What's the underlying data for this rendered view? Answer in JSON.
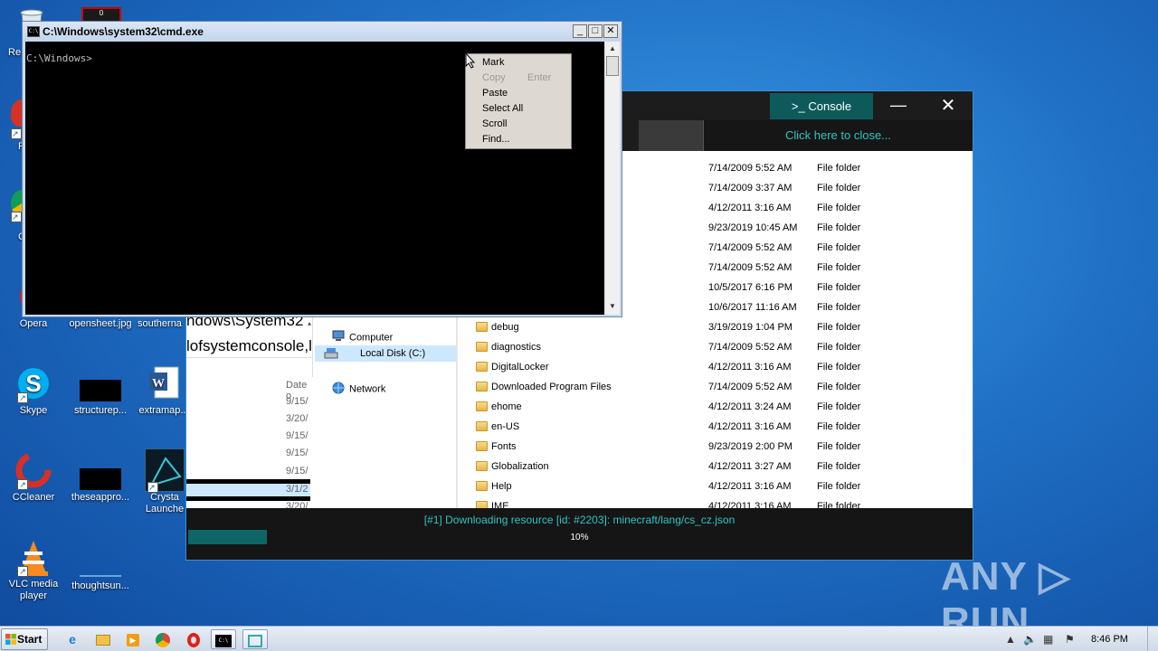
{
  "desktop": {
    "icons": [
      {
        "label": "Re",
        "name": "recycle-bin"
      },
      {
        "label": "Opera",
        "name": "opera"
      },
      {
        "label": "opensheet.jpg",
        "name": "opensheet"
      },
      {
        "label": "southerna",
        "name": "southerna"
      },
      {
        "label": "Skype",
        "name": "skype"
      },
      {
        "label": "structurep...",
        "name": "structurep"
      },
      {
        "label": "extramap...",
        "name": "extramap"
      },
      {
        "label": "CCleaner",
        "name": "ccleaner"
      },
      {
        "label": "theseappro...",
        "name": "theseappro"
      },
      {
        "label": "Crysta Launche",
        "name": "crystal-launcher"
      },
      {
        "label": "VLC media player",
        "name": "vlc"
      },
      {
        "label": "thoughtsun...",
        "name": "thoughtsun"
      }
    ],
    "partial_labels": [
      "F",
      "C"
    ]
  },
  "cmd": {
    "title": "C:\\Windows\\system32\\cmd.exe",
    "prompt": "C:\\Windows>",
    "menu": {
      "mark": "Mark",
      "copy": "Copy",
      "copy_shortcut": "Enter",
      "paste": "Paste",
      "select_all": "Select All",
      "scroll": "Scroll",
      "find": "Find..."
    }
  },
  "app": {
    "console_button": ">_ Console",
    "click_to_close": "Click here to close...",
    "status": "[#1] Downloading resource [id: #2203]: minecraft/lang/cs_cz.json",
    "progress_label": "10%",
    "progress_value": 0.1
  },
  "explorer": {
    "path_line1": "ndows\\System32",
    "path_line2": "lofsystemconsole,l",
    "date_header": "Date o",
    "date_cells": [
      "9/15/",
      "3/20/",
      "9/15/",
      "9/15/",
      "9/15/",
      "3/1/2",
      "3/20/"
    ],
    "nav": {
      "computer": "Computer",
      "local_disk": "Local Disk (C:)",
      "network": "Network"
    },
    "files": [
      {
        "name": "",
        "date": "7/14/2009 5:52 AM",
        "type": "File folder"
      },
      {
        "name": "",
        "date": "7/14/2009 3:37 AM",
        "type": "File folder"
      },
      {
        "name": "",
        "date": "4/12/2011 3:16 AM",
        "type": "File folder"
      },
      {
        "name": "",
        "date": "9/23/2019 10:45 AM",
        "type": "File folder"
      },
      {
        "name": "",
        "date": "7/14/2009 5:52 AM",
        "type": "File folder"
      },
      {
        "name": "",
        "date": "7/14/2009 5:52 AM",
        "type": "File folder"
      },
      {
        "name": "",
        "date": "10/5/2017 6:16 PM",
        "type": "File folder"
      },
      {
        "name": "",
        "date": "10/6/2017 11:16 AM",
        "type": "File folder"
      },
      {
        "name": "debug",
        "date": "3/19/2019 1:04 PM",
        "type": "File folder"
      },
      {
        "name": "diagnostics",
        "date": "7/14/2009 5:52 AM",
        "type": "File folder"
      },
      {
        "name": "DigitalLocker",
        "date": "4/12/2011 3:16 AM",
        "type": "File folder"
      },
      {
        "name": "Downloaded Program Files",
        "date": "7/14/2009 5:52 AM",
        "type": "File folder"
      },
      {
        "name": "ehome",
        "date": "4/12/2011 3:24 AM",
        "type": "File folder"
      },
      {
        "name": "en-US",
        "date": "4/12/2011 3:16 AM",
        "type": "File folder"
      },
      {
        "name": "Fonts",
        "date": "9/23/2019 2:00 PM",
        "type": "File folder"
      },
      {
        "name": "Globalization",
        "date": "4/12/2011 3:27 AM",
        "type": "File folder"
      },
      {
        "name": "Help",
        "date": "4/12/2011 3:16 AM",
        "type": "File folder"
      },
      {
        "name": "IME",
        "date": "4/12/2011 3:16 AM",
        "type": "File folder"
      }
    ]
  },
  "taskbar": {
    "start": "Start",
    "clock": "8:46 PM"
  },
  "watermark": "ANY RUN",
  "colors": {
    "accent_teal": "#0e5a5a",
    "status_text": "#33c3c3",
    "desktop_blue": "#1f6fc4"
  }
}
